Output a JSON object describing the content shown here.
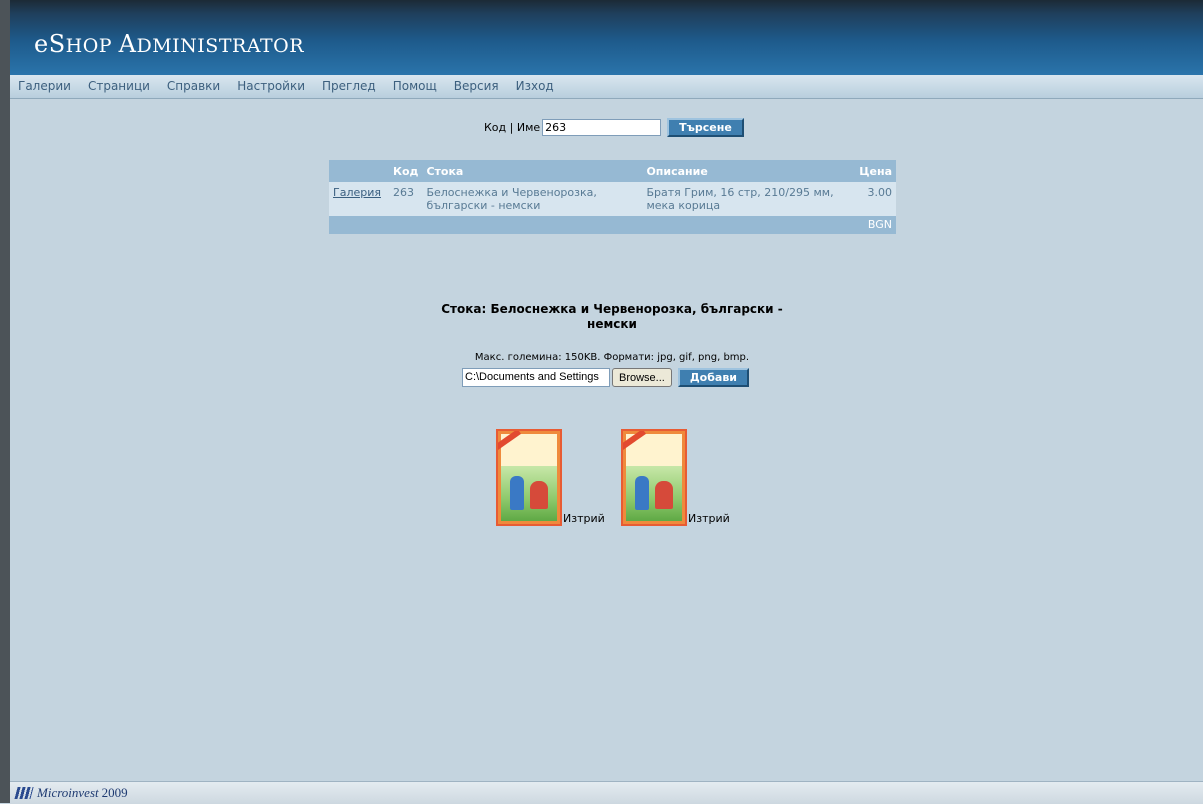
{
  "header": {
    "title_first": "e",
    "title_rest_a": "S",
    "title_rest_b": "HOP ",
    "title_rest_c": "A",
    "title_rest_d": "DMINISTRATOR"
  },
  "menu": [
    "Галерии",
    "Страници",
    "Справки",
    "Настройки",
    "Преглед",
    "Помощ",
    "Версия",
    "Изход"
  ],
  "search": {
    "label": "Код | Име",
    "value": "263",
    "button": "Търсене"
  },
  "results": {
    "headers": {
      "code": "Код",
      "item": "Стока",
      "description": "Описание",
      "price": "Цена"
    },
    "rows": [
      {
        "link": "Галерия",
        "code": "263",
        "item": "Белоснежка и Червенорозка, български - немски",
        "description": "Братя Грим, 16 стр, 210/295 мм, мека корица",
        "price": "3.00"
      }
    ],
    "currency": "BGN"
  },
  "product": {
    "heading": "Стока: Белоснежка и Червенорозка, български - немски"
  },
  "upload": {
    "info": "Макс. големина: 150KB. Формати: jpg, gif, png, bmp.",
    "file_value": "C:\\Documents and Settings",
    "browse": "Browse...",
    "add": "Добави"
  },
  "images": [
    {
      "delete": "Изтрий"
    },
    {
      "delete": "Изтрий"
    }
  ],
  "footer": {
    "brand": "Microinvest",
    "year": "2009"
  }
}
